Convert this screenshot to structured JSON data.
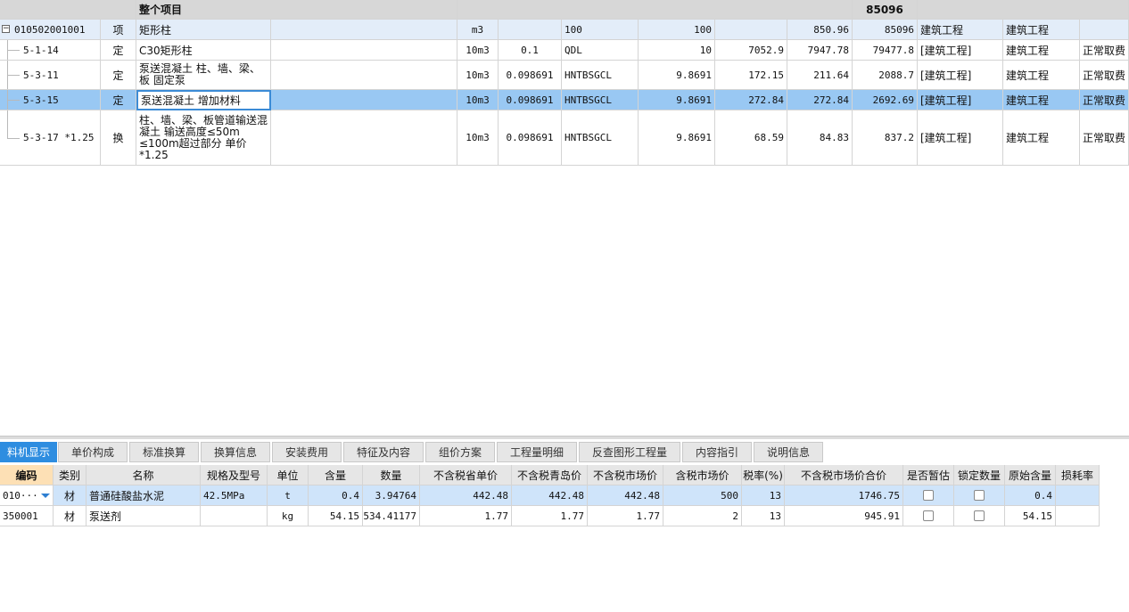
{
  "top_header": {
    "label": "整个项目",
    "total": "85096"
  },
  "rows": [
    {
      "code": "010502001001",
      "type": "项",
      "name": "矩形柱",
      "unit": "m3",
      "qtyexp": "",
      "qty_code": "100",
      "qty": "100",
      "c9": "",
      "price": "850.96",
      "total": "85096",
      "cat": "建筑工程",
      "cat2": "建筑工程",
      "fee": ""
    },
    {
      "code": "5-1-14",
      "type": "定",
      "name": "C30矩形柱",
      "unit": "10m3",
      "qtyexp": "0.1",
      "qty_code": "QDL",
      "qty": "10",
      "c9": "7052.9",
      "price": "7947.78",
      "total": "79477.8",
      "cat": "[建筑工程]",
      "cat2": "建筑工程",
      "fee": "正常取费"
    },
    {
      "code": "5-3-11",
      "type": "定",
      "name": "泵送混凝土 柱、墙、梁、板 固定泵",
      "unit": "10m3",
      "qtyexp": "0.098691",
      "qty_code": "HNTBSGCL",
      "qty": "9.8691",
      "c9": "172.15",
      "price": "211.64",
      "total": "2088.7",
      "cat": "[建筑工程]",
      "cat2": "建筑工程",
      "fee": "正常取费"
    },
    {
      "code": "5-3-15",
      "type": "定",
      "name": "泵送混凝土 增加材料",
      "unit": "10m3",
      "qtyexp": "0.098691",
      "qty_code": "HNTBSGCL",
      "qty": "9.8691",
      "c9": "272.84",
      "price": "272.84",
      "total": "2692.69",
      "cat": "[建筑工程]",
      "cat2": "建筑工程",
      "fee": "正常取费"
    },
    {
      "code": "5-3-17 *1.25",
      "type": "换",
      "name": "柱、墙、梁、板管道输送混凝土 输送高度≤50m ≤100m超过部分 单价*1.25",
      "unit": "10m3",
      "qtyexp": "0.098691",
      "qty_code": "HNTBSGCL",
      "qty": "9.8691",
      "c9": "68.59",
      "price": "84.83",
      "total": "837.2",
      "cat": "[建筑工程]",
      "cat2": "建筑工程",
      "fee": "正常取费"
    }
  ],
  "tabs": [
    "料机显示",
    "单价构成",
    "标准换算",
    "换算信息",
    "安装费用",
    "特征及内容",
    "组价方案",
    "工程量明细",
    "反查图形工程量",
    "内容指引",
    "说明信息"
  ],
  "bottom_headers": [
    "编码",
    "类别",
    "名称",
    "规格及型号",
    "单位",
    "含量",
    "数量",
    "不含税省单价",
    "不含税青岛价",
    "不含税市场价",
    "含税市场价",
    "税率(%)",
    "不含税市场价合价",
    "是否暂估",
    "锁定数量",
    "原始含量",
    "损耗率"
  ],
  "bottom_rows": [
    {
      "code": "010···",
      "cat": "材",
      "name": "普通硅酸盐水泥",
      "spec": "42.5MPa",
      "unit": "t",
      "content": "0.4",
      "qty": "3.94764",
      "p1": "442.48",
      "p2": "442.48",
      "p3": "442.48",
      "p4": "500",
      "tax": "13",
      "sum": "1746.75",
      "orig": "0.4",
      "loss": ""
    },
    {
      "code": "350001",
      "cat": "材",
      "name": "泵送剂",
      "spec": "",
      "unit": "kg",
      "content": "54.15",
      "qty": "534.41177",
      "p1": "1.77",
      "p2": "1.77",
      "p3": "1.77",
      "p4": "2",
      "tax": "13",
      "sum": "945.91",
      "orig": "54.15",
      "loss": ""
    }
  ]
}
